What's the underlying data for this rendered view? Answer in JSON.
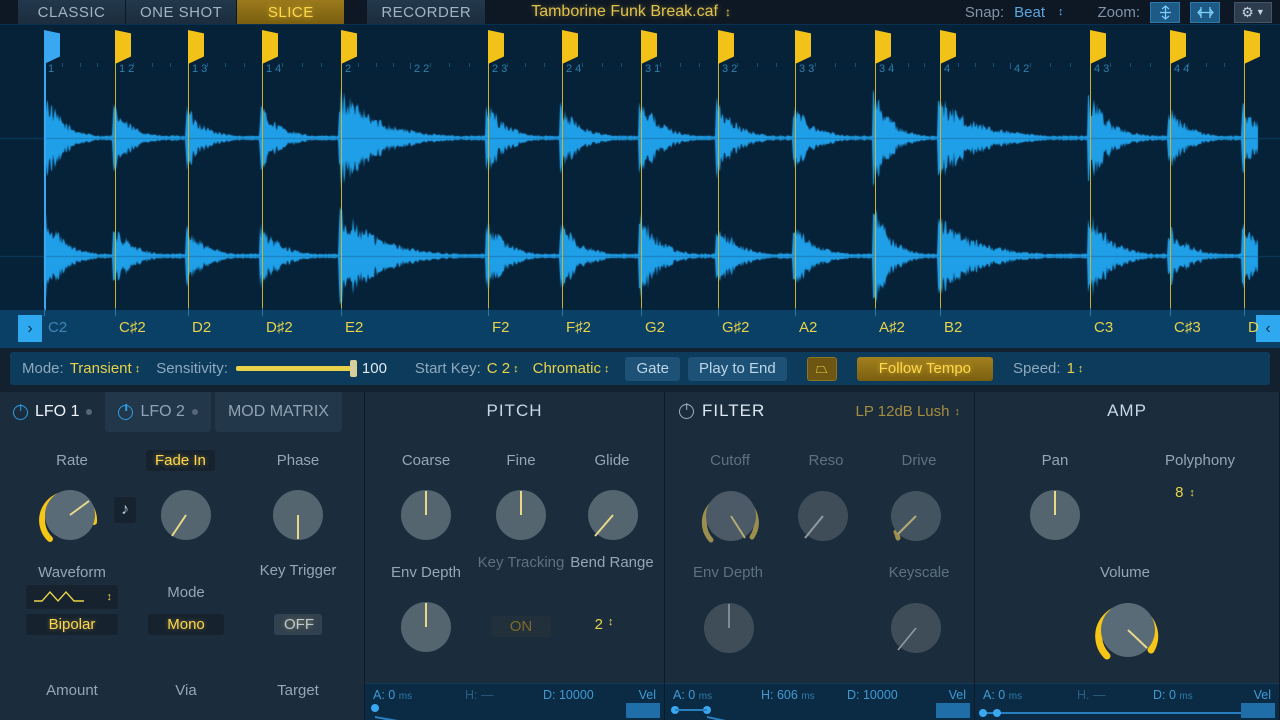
{
  "toolbar": {
    "modes": [
      {
        "label": "CLASSIC",
        "active": false
      },
      {
        "label": "ONE SHOT",
        "active": false
      },
      {
        "label": "SLICE",
        "active": true
      },
      {
        "label": "RECORDER",
        "active": false
      }
    ],
    "file_name": "Tamborine Funk Break.caf",
    "snap_label": "Snap:",
    "snap_value": "Beat",
    "zoom_label": "Zoom:",
    "zoom_vertical_icon": "zoom-vertical-icon",
    "zoom_horizontal_icon": "zoom-horizontal-icon",
    "gear_icon": "gear-icon",
    "accent_yellow": "#ffd84a",
    "accent_blue": "#3aa8f0"
  },
  "waveform": {
    "ruler_labels": [
      "1",
      "1 2",
      "1 3",
      "1 4",
      "2",
      "2 2",
      "2 3",
      "2 4",
      "3 1",
      "3 2",
      "3 3",
      "3 4",
      "4",
      "4 2",
      "4 3",
      "4 4"
    ],
    "slice_marker_color": "#f2c218",
    "selected_marker_color": "#3aa8f0",
    "wave_color": "#1f9fe8",
    "background": "#062239"
  },
  "keystrip": {
    "left_scroll_icon": "chevron-right-icon",
    "right_scroll_icon": "chevron-left-icon",
    "keys": [
      {
        "label": "C2",
        "dim": true
      },
      {
        "label": "C♯2",
        "dim": false
      },
      {
        "label": "D2",
        "dim": false
      },
      {
        "label": "D♯2",
        "dim": false
      },
      {
        "label": "E2",
        "dim": false
      },
      {
        "label": "F2",
        "dim": false
      },
      {
        "label": "F♯2",
        "dim": false
      },
      {
        "label": "G2",
        "dim": false
      },
      {
        "label": "G♯2",
        "dim": false
      },
      {
        "label": "A2",
        "dim": false
      },
      {
        "label": "A♯2",
        "dim": false
      },
      {
        "label": "B2",
        "dim": false
      },
      {
        "label": "C3",
        "dim": false
      },
      {
        "label": "C♯3",
        "dim": false
      },
      {
        "label": "D",
        "dim": false
      }
    ]
  },
  "parambar": {
    "mode_label": "Mode:",
    "mode_value": "Transient",
    "sensitivity_label": "Sensitivity:",
    "sensitivity_value": "100",
    "sensitivity_pct": 100,
    "start_key_label": "Start Key:",
    "start_key_value": "C 2",
    "scale_value": "Chromatic",
    "gate_label": "Gate",
    "play_to_end_label": "Play to End",
    "reverse_icon": "reverse-playback-icon",
    "follow_tempo_label": "Follow Tempo",
    "speed_label": "Speed:",
    "speed_value": "1"
  },
  "lfo": {
    "tabs": [
      {
        "label": "LFO 1",
        "active": true,
        "power_icon": "power-icon"
      },
      {
        "label": "LFO 2",
        "active": false,
        "power_icon": "power-icon"
      },
      {
        "label": "MOD MATRIX",
        "active": false,
        "power_icon": null
      }
    ],
    "rate_label": "Rate",
    "fade_in_label": "Fade In",
    "phase_label": "Phase",
    "note_icon": "music-note-icon",
    "waveform_label": "Waveform",
    "waveform_icon": "triangle-wave-icon",
    "polarity_value": "Bipolar",
    "mode_label": "Mode",
    "mode_value": "Mono",
    "key_trigger_label": "Key Trigger",
    "key_trigger_value": "OFF",
    "amount_label": "Amount",
    "via_label": "Via",
    "target_label": "Target"
  },
  "pitch": {
    "title": "PITCH",
    "coarse_label": "Coarse",
    "fine_label": "Fine",
    "glide_label": "Glide",
    "env_depth_label": "Env Depth",
    "key_tracking_label": "Key Tracking",
    "key_tracking_value": "ON",
    "bend_range_label": "Bend Range",
    "bend_range_value": "2",
    "env": {
      "attack": "A: 0",
      "attack_unit": "ms",
      "hold": "H:",
      "hold_value": "—",
      "decay": "D: 10000",
      "vel": "Vel"
    }
  },
  "filter": {
    "title": "FILTER",
    "power_icon": "power-icon",
    "type_value": "LP 12dB Lush",
    "cutoff_label": "Cutoff",
    "reso_label": "Reso",
    "drive_label": "Drive",
    "env_depth_label": "Env Depth",
    "keyscale_label": "Keyscale",
    "env": {
      "attack": "A: 0",
      "attack_unit": "ms",
      "hold": "H: 606",
      "hold_unit": "ms",
      "decay": "D: 10000",
      "vel": "Vel"
    }
  },
  "amp": {
    "title": "AMP",
    "pan_label": "Pan",
    "polyphony_label": "Polyphony",
    "polyphony_value": "8",
    "volume_label": "Volume",
    "env": {
      "attack": "A: 0",
      "attack_unit": "ms",
      "hold": "H.",
      "hold_value": "—",
      "decay": "D: 0",
      "decay_unit": "ms",
      "vel": "Vel"
    }
  }
}
